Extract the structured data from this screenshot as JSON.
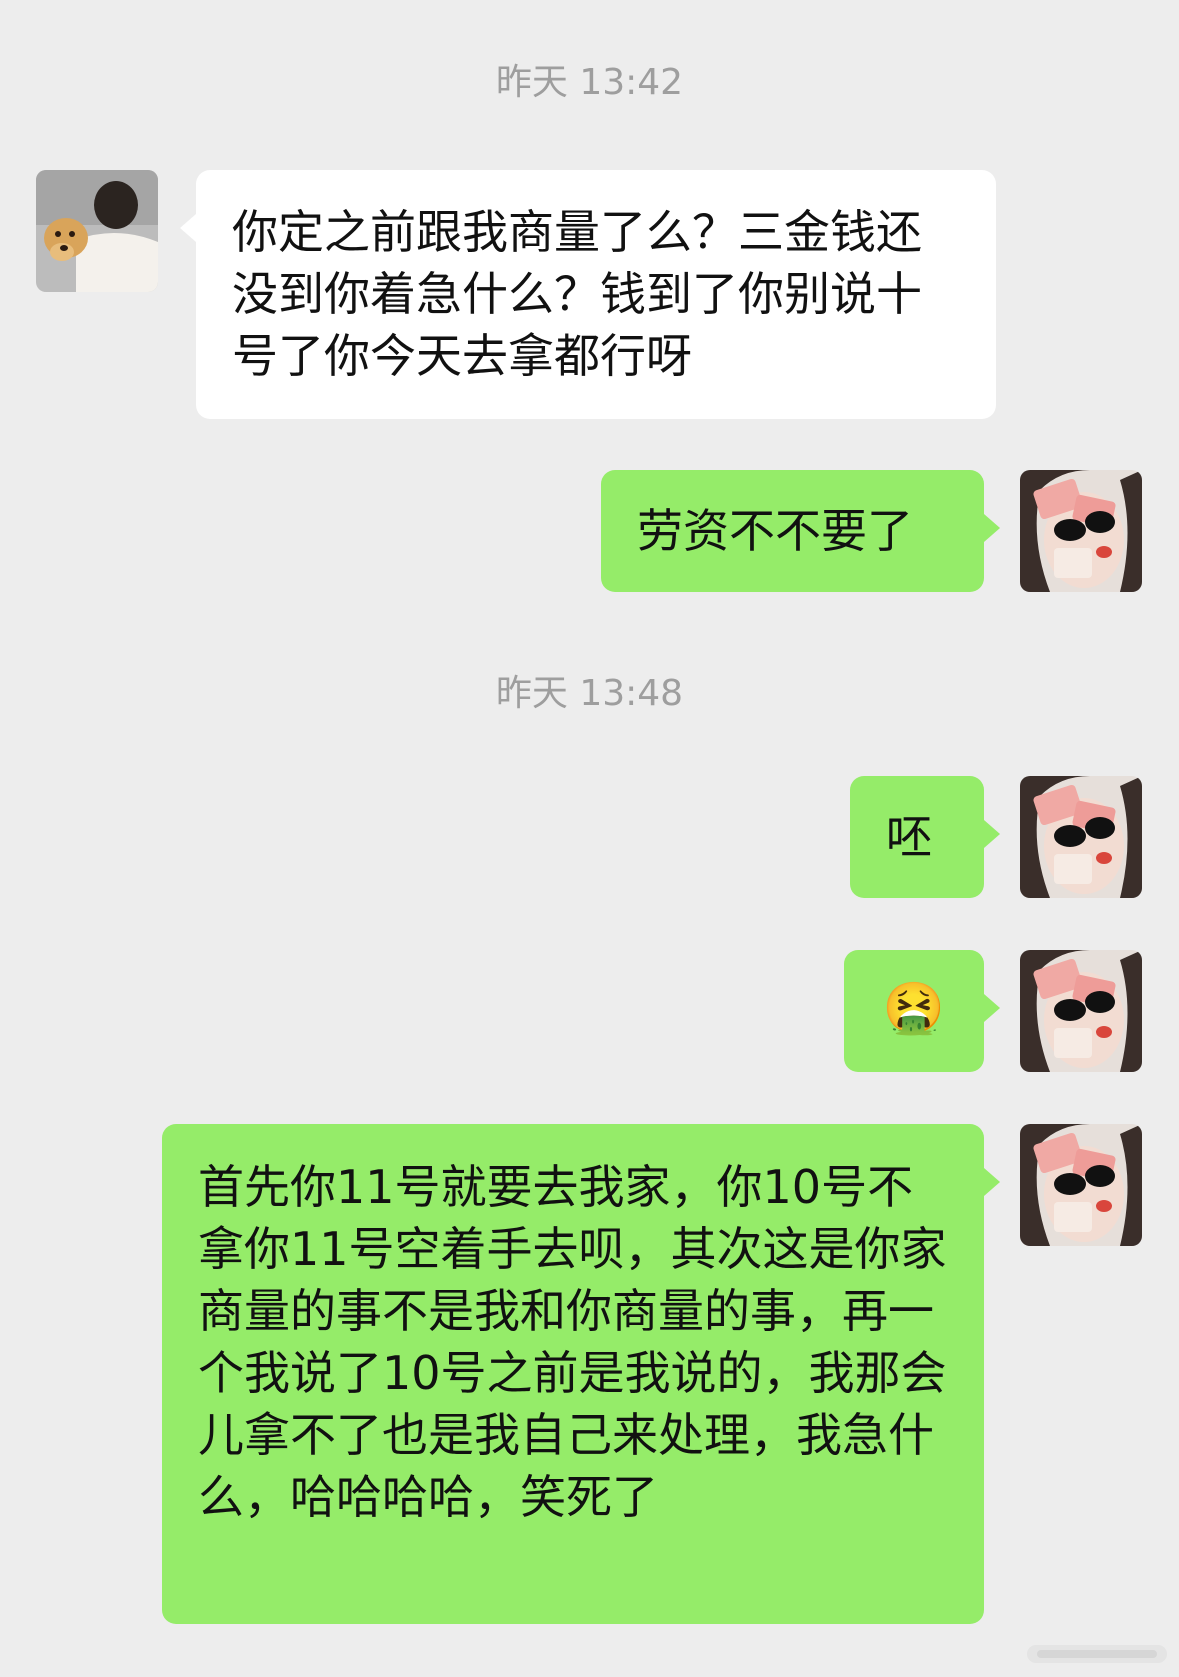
{
  "chat": {
    "timestamps": [
      "昨天 13:42",
      "昨天 13:48"
    ],
    "messages": [
      {
        "side": "left",
        "text": "你定之前跟我商量了么？三金钱还没到你着急什么？钱到了你别说十号了你今天去拿都行呀"
      },
      {
        "side": "right",
        "text": "劳资不不要了"
      },
      {
        "side": "right",
        "text": "呸"
      },
      {
        "side": "right",
        "icon": "vomiting-face-emoji",
        "text": "🤮"
      },
      {
        "side": "right",
        "text": "首先你11号就要去我家，你10号不拿你11号空着手去呗，其次这是你家商量的事不是我和你商量的事，再一个我说了10号之前是我说的，我那会儿拿不了也是我自己来处理，我急什么，哈哈哈哈，笑死了"
      }
    ]
  },
  "colors": {
    "background": "#ededed",
    "incoming_bubble": "#ffffff",
    "outgoing_bubble": "#95ec69",
    "timestamp_text": "#9e9e9e"
  }
}
